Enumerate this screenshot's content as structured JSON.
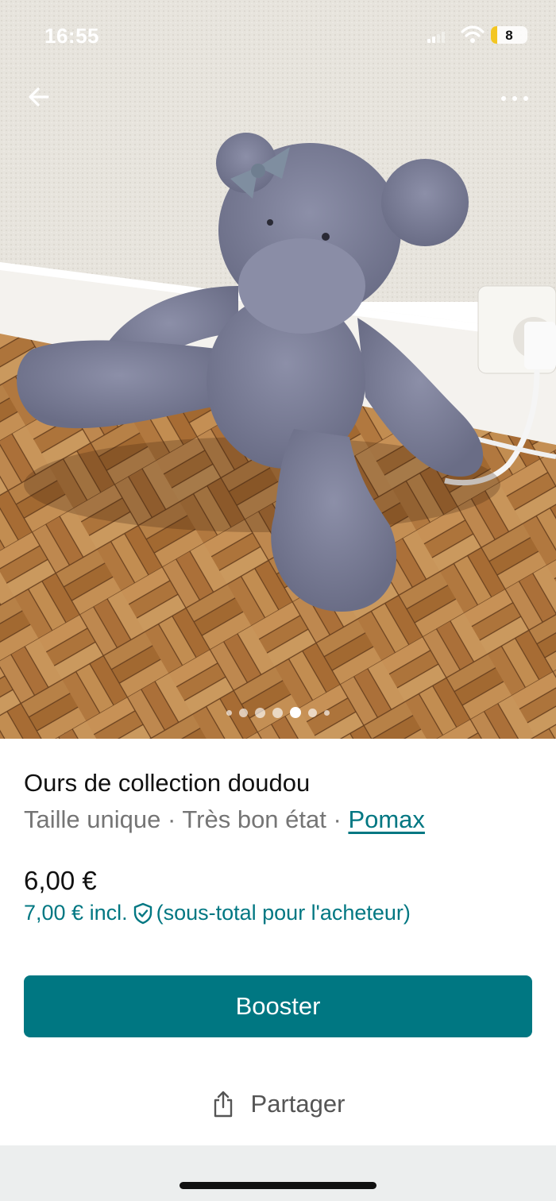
{
  "status_bar": {
    "time": "16:55",
    "battery_level": "8",
    "icons": [
      "cellular-signal-icon",
      "wifi-icon",
      "battery-icon"
    ]
  },
  "top_bar": {
    "back_icon": "arrow-left-icon",
    "more_icon": "more-dots-icon"
  },
  "gallery": {
    "image_count": 7,
    "active_index": 4
  },
  "listing": {
    "title": "Ours de collection doudou",
    "size": "Taille unique",
    "separator": " · ",
    "condition": "Très bon état",
    "seller": "Pomax",
    "price": "6,00 €",
    "price_incl_prefix": "7,00 € incl.",
    "price_incl_suffix": "(sous-total pour l'acheteur)",
    "protection_icon": "shield-check-icon"
  },
  "actions": {
    "booster_label": "Booster",
    "share_label": "Partager",
    "share_icon": "share-icon"
  },
  "colors": {
    "brand": "#007782",
    "text_primary": "#111111",
    "text_secondary": "#757575"
  }
}
